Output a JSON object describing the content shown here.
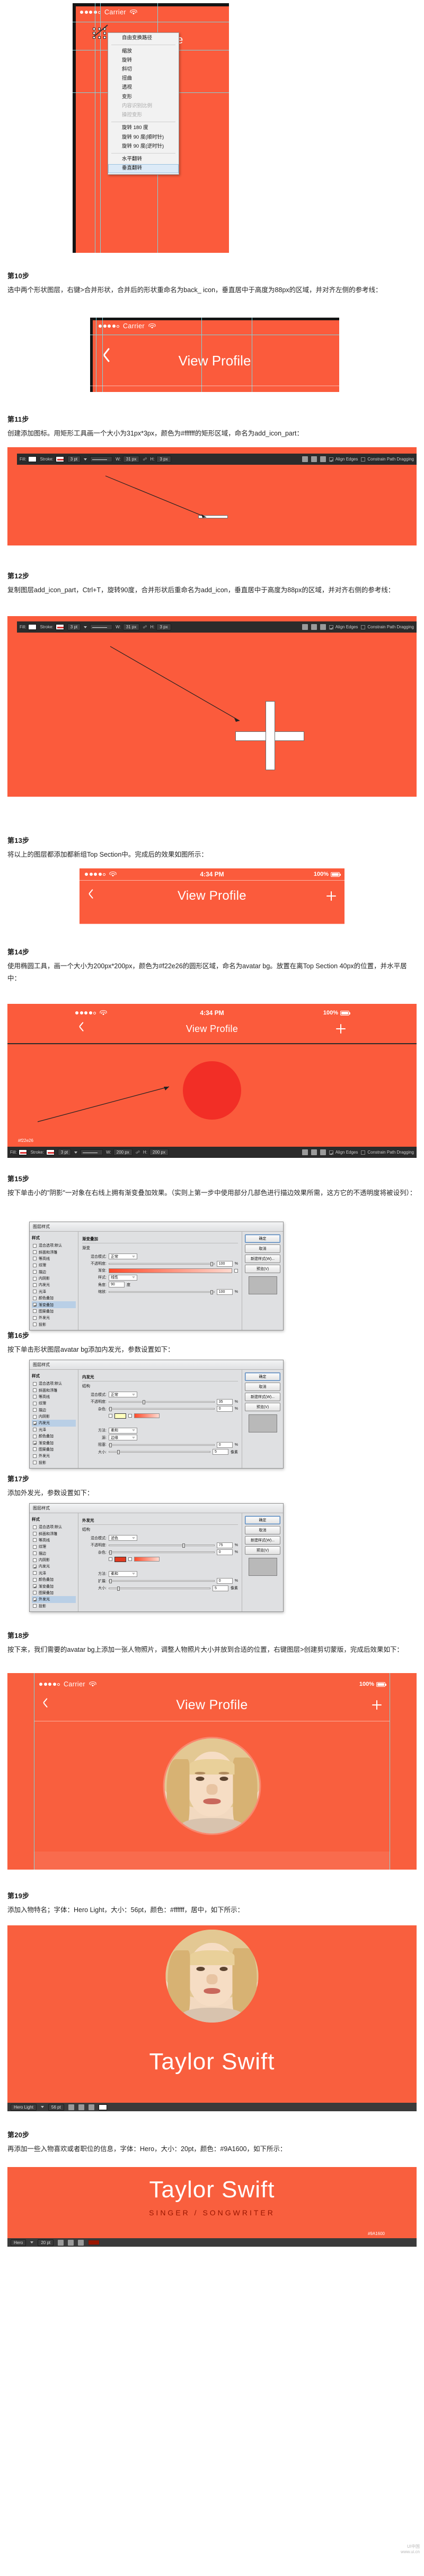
{
  "mock_common": {
    "carrier": "Carrier",
    "time": "4:34 PM",
    "battery": "100%",
    "nav_title": "View Profile"
  },
  "context_menu": {
    "items": [
      {
        "label": "自由变换路径",
        "state": "normal"
      },
      {
        "label": "缩放",
        "state": "normal"
      },
      {
        "label": "旋转",
        "state": "normal"
      },
      {
        "label": "斜切",
        "state": "normal"
      },
      {
        "label": "扭曲",
        "state": "normal"
      },
      {
        "label": "透视",
        "state": "normal"
      },
      {
        "label": "变形",
        "state": "normal"
      },
      {
        "label": "内容识别比例",
        "state": "disabled"
      },
      {
        "label": "操控变形",
        "state": "disabled"
      },
      {
        "label": "旋转 180 度",
        "state": "normal"
      },
      {
        "label": "旋转 90 度(顺时针)",
        "state": "normal"
      },
      {
        "label": "旋转 90 度(逆时针)",
        "state": "normal"
      },
      {
        "label": "水平翻转",
        "state": "normal"
      },
      {
        "label": "垂直翻转",
        "state": "selected"
      }
    ]
  },
  "steps": [
    {
      "id": "step10",
      "title": "第10步",
      "text": "选中两个形状图层，右键>合并形状，合并后的形状重命名为back_ icon，垂直居中于高度为88px的区域，并对齐左侧的参考线："
    },
    {
      "id": "step11",
      "title": "第11步",
      "text": "创建添加图标。用矩形工具画一个大小为31px*3px，颜色为#ffffff的矩形区域，命名为add_icon_part："
    },
    {
      "id": "step12",
      "title": "第12步",
      "text": "复制图层add_icon_part，Ctrl+T，旋转90度，合并形状后重命名为add_icon，垂直居中于高度为88px的区域，并对齐右侧的参考线："
    },
    {
      "id": "step13",
      "title": "第13步",
      "text": "将以上的图层都添加都新组Top Section中。完成后的效果如图所示："
    },
    {
      "id": "step14",
      "title": "第14步",
      "text": "使用椭圆工具，画一个大小为200px*200px，颜色为#f22e26的圆形区域，命名为avatar bg。放置在离Top Section 40px的位置，并水平居中："
    },
    {
      "id": "step15",
      "title": "第15步",
      "text": "按下单击小的\"阴影\"一对象在右线上拥有渐变叠加效果。（实则上第一步中使用部分几部色进行描边效果所需，这方它的不透明度将被设列）："
    },
    {
      "id": "step16",
      "title": "第16步",
      "text": "按下单击形状图层avatar bg添加内发光，参数设置如下："
    },
    {
      "id": "step17",
      "title": "第17步",
      "text": "添加外发光，参数设置如下："
    },
    {
      "id": "step18",
      "title": "第18步",
      "text": "按下来，我们需要的avatar bg上添加一张人物照片，调整人物照片大小并放到合适的位置，右键图层>创建剪切蒙版，完成后效果如下："
    },
    {
      "id": "step19",
      "title": "第19步",
      "text": "添加入物特名；字体：Hero Light，大小：56pt，颜色：#ffffff，居中，如下所示："
    },
    {
      "id": "step20",
      "title": "第20步",
      "text": "再添加一些入物喜欢或者职位的信息，字体：Hero，大小：20pt，颜色：#9A1600，如下所示："
    }
  ],
  "ps_options_bar": {
    "fill_label": "Fill:",
    "stroke_label": "Stroke:",
    "stroke_weight": "3 pt",
    "w_label": "W:",
    "w_value": "31 px",
    "h_label": "H:",
    "h_value": "3 px",
    "align_edges": "Align Edges",
    "constrain": "Constrain Path Dragging"
  },
  "ps_options_bar_2": {
    "fill_label": "Fill:",
    "stroke_label": "Stroke:",
    "stroke_weight": "3 pt",
    "w_label": "W:",
    "w_value": "200 px",
    "h_label": "H:",
    "h_value": "200 px",
    "align_edges": "Align Edges",
    "constrain": "Constrain Path Dragging"
  },
  "callouts": {
    "color_f22e26": "#f22e26",
    "color_9a1600": "#9A1600"
  },
  "dialog_gradient": {
    "title": "图层样式",
    "left_header": "样式",
    "left_items": [
      {
        "label": "混合选项:默认",
        "checked": false,
        "active": false
      },
      {
        "label": "斜面和浮雕",
        "checked": false,
        "active": false
      },
      {
        "label": "等高线",
        "checked": false,
        "active": false
      },
      {
        "label": "纹理",
        "checked": false,
        "active": false
      },
      {
        "label": "描边",
        "checked": false,
        "active": false
      },
      {
        "label": "内阴影",
        "checked": false,
        "active": false
      },
      {
        "label": "内发光",
        "checked": false,
        "active": false
      },
      {
        "label": "光泽",
        "checked": false,
        "active": false
      },
      {
        "label": "颜色叠加",
        "checked": false,
        "active": false
      },
      {
        "label": "渐变叠加",
        "checked": true,
        "active": true
      },
      {
        "label": "图案叠加",
        "checked": false,
        "active": false
      },
      {
        "label": "外发光",
        "checked": false,
        "active": false
      },
      {
        "label": "投影",
        "checked": false,
        "active": false
      }
    ],
    "group_title": "渐变叠加",
    "sub_title": "渐变",
    "rows": [
      {
        "label": "混合模式:",
        "value": "正常"
      },
      {
        "label": "不透明度:",
        "value": "100",
        "unit": "%"
      },
      {
        "label": "渐变:",
        "value": ""
      },
      {
        "label": "样式:",
        "value": "线性"
      },
      {
        "label": "角度:",
        "value": "90",
        "unit": "度"
      },
      {
        "label": "缩放:",
        "value": "100",
        "unit": "%"
      }
    ],
    "buttons": [
      "确定",
      "取消",
      "新建样式(W)...",
      "预览(V)"
    ]
  },
  "dialog_inner_glow": {
    "title": "图层样式",
    "group_title": "内发光",
    "sub_title": "结构",
    "rows": [
      {
        "label": "混合模式:",
        "value": "正常"
      },
      {
        "label": "不透明度:",
        "value": "35",
        "unit": "%"
      },
      {
        "label": "杂色:",
        "value": "0",
        "unit": "%"
      },
      {
        "label": "方法:",
        "value": "柔和"
      },
      {
        "label": "源:",
        "value": "边缘"
      },
      {
        "label": "阻塞:",
        "value": "0",
        "unit": "%"
      },
      {
        "label": "大小:",
        "value": "5",
        "unit": "像素"
      }
    ],
    "buttons": [
      "确定",
      "取消",
      "新建样式(W)...",
      "预览(V)"
    ]
  },
  "dialog_outer_glow": {
    "title": "图层样式",
    "group_title": "外发光",
    "sub_title": "结构",
    "rows": [
      {
        "label": "混合模式:",
        "value": "滤色"
      },
      {
        "label": "不透明度:",
        "value": "75",
        "unit": "%"
      },
      {
        "label": "杂色:",
        "value": "0",
        "unit": "%"
      },
      {
        "label": "方法:",
        "value": "柔和"
      },
      {
        "label": "扩展:",
        "value": "0",
        "unit": "%"
      },
      {
        "label": "大小:",
        "value": "5",
        "unit": "像素"
      }
    ],
    "buttons": [
      "确定",
      "取消",
      "新建样式(W)...",
      "预览(V)"
    ]
  },
  "final_preview": {
    "name": "Taylor Swift",
    "subtitle": "SINGER / SONGWRITER",
    "color_note": "#9A1600"
  },
  "ps_footer": {
    "font_name": "Hero Light",
    "font_size": "56 pt",
    "font_name2": "Hero",
    "font_size2": "20 pt"
  },
  "watermark": {
    "line1": "UI中国",
    "line2": "www.ui.cn"
  }
}
